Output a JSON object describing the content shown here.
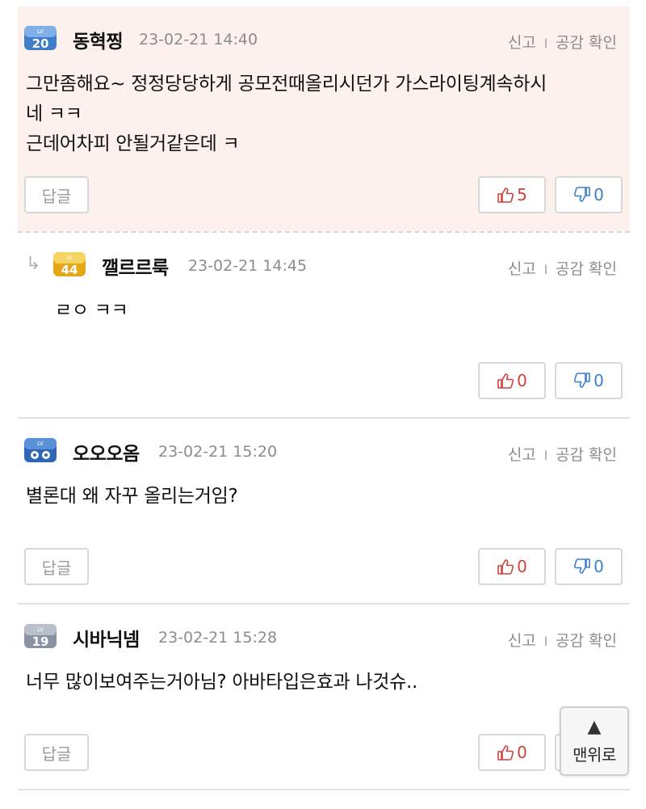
{
  "actions": {
    "report": "신고",
    "separator": "l",
    "empathy_check": "공감 확인"
  },
  "reply_button": "답글",
  "comments": [
    {
      "level": "20",
      "author": "동혁찡",
      "date": "23-02-21 14:40",
      "lines": [
        "그만좀해요~ 정정당당하게 공모전때올리시던가 가스라이팅계속하시",
        "네 ㅋㅋ",
        "근데어차피 안될거같은데 ㅋ"
      ],
      "likes": "5",
      "dislikes": "0"
    },
    {
      "level": "44",
      "author": "깰르르룩",
      "date": "23-02-21 14:45",
      "lines": [
        "ㄹㅇ ㅋㅋ"
      ],
      "likes": "0",
      "dislikes": "0",
      "is_reply": true
    },
    {
      "level": "",
      "author": "오오오옴",
      "date": "23-02-21 15:20",
      "lines": [
        "별론대 왜 자꾸 올리는거임?"
      ],
      "likes": "0",
      "dislikes": "0"
    },
    {
      "level": "19",
      "author": "시바닉넴",
      "date": "23-02-21 15:28",
      "lines": [
        "너무 많이보여주는거아님? 아바타입은효과 나것슈.."
      ],
      "likes": "0",
      "dislikes": ""
    }
  ],
  "reply_arrow": "↳",
  "scroll_top": {
    "arrow": "▲",
    "label": "맨위로"
  },
  "colors": {
    "highlight_bg": "#fdf1ee",
    "like": "#d0423a",
    "dislike": "#3b7fd0",
    "meta": "#8c8c8c",
    "badge_blue": "#3f7cc9",
    "badge_gold": "#e4a816",
    "badge_gray": "#8a93a3"
  },
  "icons": {
    "like": "thumbs-up-icon",
    "dislike": "thumbs-down-icon",
    "reply": "reply-arrow-icon"
  }
}
